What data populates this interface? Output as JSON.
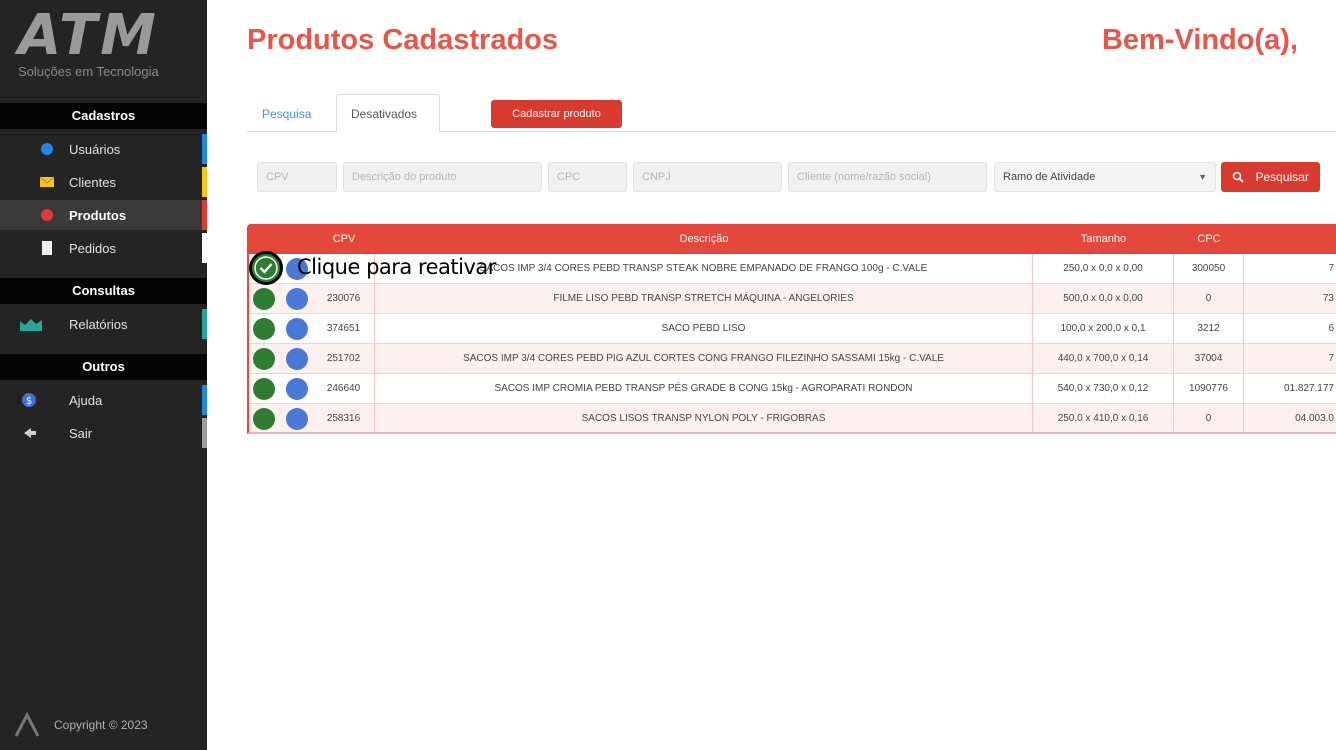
{
  "brand": {
    "logo": "ATM",
    "tagline": "Soluções em Tecnologia"
  },
  "sidebar": {
    "sections": [
      {
        "title": "Cadastros",
        "items": [
          {
            "label": "Usuários",
            "icon": "user-icon",
            "accent": "#1e88e5"
          },
          {
            "label": "Clientes",
            "icon": "envelope-icon",
            "accent": "#f5c518"
          },
          {
            "label": "Produtos",
            "icon": "circle-icon",
            "accent": "#e53935",
            "active": true
          },
          {
            "label": "Pedidos",
            "icon": "document-icon",
            "accent": "#ffffff"
          }
        ]
      },
      {
        "title": "Consultas",
        "items": [
          {
            "label": "Relatórios",
            "icon": "chart-icon",
            "accent": "#26a69a"
          }
        ]
      },
      {
        "title": "Outros",
        "items": [
          {
            "label": "Ajuda",
            "icon": "help-icon",
            "accent": "#1e88e5"
          },
          {
            "label": "Sair",
            "icon": "exit-icon",
            "accent": "#9e9e9e"
          }
        ]
      }
    ],
    "copyright": "Copyright © 2023"
  },
  "header": {
    "title": "Produtos Cadastrados",
    "welcome": "Bem-Vindo(a),"
  },
  "tabs": [
    {
      "label": "Pesquisa"
    },
    {
      "label": "Desativados",
      "active": true
    }
  ],
  "actions": {
    "cadastrar": "Cadastrar produto"
  },
  "filters": {
    "cpv": "CPV",
    "descricao": "Descrição do produto",
    "cpc": "CPC",
    "cnpj": "CNPJ",
    "cliente": "Cliente (nome/razão social)",
    "ramo": "Ramo de Atividade",
    "search_button": "Pesquisar"
  },
  "table": {
    "headers": [
      "CPV",
      "Descrição",
      "Tamanho",
      "CPC",
      ""
    ],
    "rows": [
      {
        "cpv": "",
        "descricao": "SACOS IMP 3/4 CORES PEBD TRANSP STEAK NOBRE EMPANADO DE FRANGO 100g - C.VALE",
        "tamanho": "250,0 x 0,0 x 0,00",
        "cpc": "300050",
        "extra": "7"
      },
      {
        "cpv": "230076",
        "descricao": "FILME LISO PEBD TRANSP STRETCH MÁQUINA - ANGELORIES",
        "tamanho": "500,0 x 0,0 x 0,00",
        "cpc": "0",
        "extra": "73"
      },
      {
        "cpv": "374651",
        "descricao": "SACO PEBD LISO",
        "tamanho": "100,0 x 200,0 x 0,1",
        "cpc": "3212",
        "extra": "6"
      },
      {
        "cpv": "251702",
        "descricao": "SACOS IMP 3/4 CORES PEBD PIG AZUL CORTES CONG FRANGO FILEZINHO SASSAMI 15kg - C.VALE",
        "tamanho": "440,0 x 700,0 x 0,14",
        "cpc": "37004",
        "extra": "7"
      },
      {
        "cpv": "246640",
        "descricao": "SACOS IMP CROMIA PEBD TRANSP PÉS GRADE B CONG 15kg - AGROPARATI RONDON",
        "tamanho": "540,0 x 730,0 x 0,12",
        "cpc": "1090776",
        "extra": "01.827.177"
      },
      {
        "cpv": "258316",
        "descricao": "SACOS LISOS TRANSP NYLON POLY - FRIGOBRAS",
        "tamanho": "250,0 x 410,0 x 0,16",
        "cpc": "0",
        "extra": "04.003.0"
      }
    ]
  },
  "tooltip": {
    "text": "Clique para reativar"
  },
  "colors": {
    "brand_red": "#e4473c",
    "title_red": "#e4574b",
    "sidebar_bg": "#242424",
    "reactivate_green": "#2e7d32",
    "edit_blue": "#4a78d6"
  }
}
